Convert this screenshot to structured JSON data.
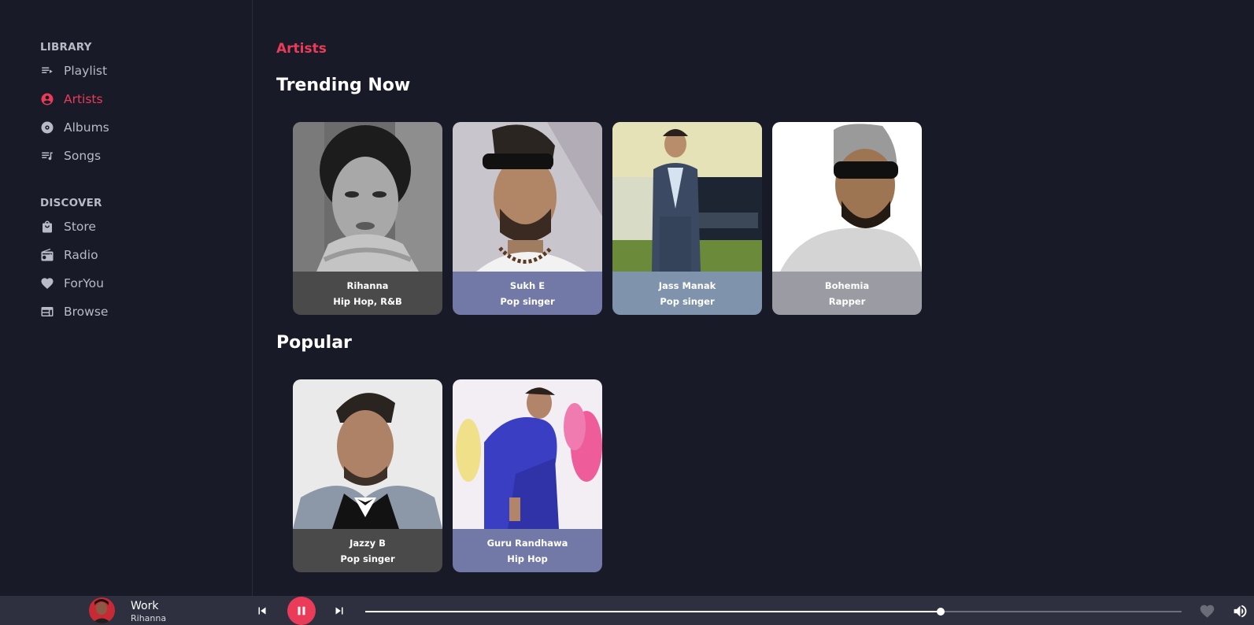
{
  "sidebar": {
    "library_title": "LIBRARY",
    "library_items": [
      {
        "label": "Playlist",
        "icon": "playlist-icon"
      },
      {
        "label": "Artists",
        "icon": "artist-icon",
        "active": true
      },
      {
        "label": "Albums",
        "icon": "album-icon"
      },
      {
        "label": "Songs",
        "icon": "songs-icon"
      }
    ],
    "discover_title": "DISCOVER",
    "discover_items": [
      {
        "label": "Store",
        "icon": "shopping-bag-icon"
      },
      {
        "label": "Radio",
        "icon": "radio-icon"
      },
      {
        "label": "ForYou",
        "icon": "heart-icon"
      },
      {
        "label": "Browse",
        "icon": "browse-icon"
      }
    ]
  },
  "main": {
    "page_title": "Artists",
    "trending_title": "Trending Now",
    "trending": [
      {
        "name": "Rihanna",
        "genre": "Hip Hop, R&B",
        "caption_color": "#4a4a4a"
      },
      {
        "name": "Sukh E",
        "genre": "Pop singer",
        "caption_color": "#7279a6"
      },
      {
        "name": "Jass Manak",
        "genre": "Pop singer",
        "caption_color": "#7f94ac"
      },
      {
        "name": "Bohemia",
        "genre": "Rapper",
        "caption_color": "#9b9ba3"
      }
    ],
    "popular_title": "Popular",
    "popular": [
      {
        "name": "Jazzy B",
        "genre": "Pop singer",
        "caption_color": "#4a4a4a"
      },
      {
        "name": "Guru Randhawa",
        "genre": "Hip Hop",
        "caption_color": "#7279a6"
      }
    ]
  },
  "player": {
    "track_title": "Work",
    "track_artist": "Rihanna",
    "progress": 0.705,
    "controls": [
      "previous-icon",
      "pause-icon",
      "next-icon",
      "heart-icon",
      "volume-icon"
    ]
  },
  "colors": {
    "accent": "#ea3c58",
    "background": "#181a27",
    "player_bar": "#2e3040"
  }
}
